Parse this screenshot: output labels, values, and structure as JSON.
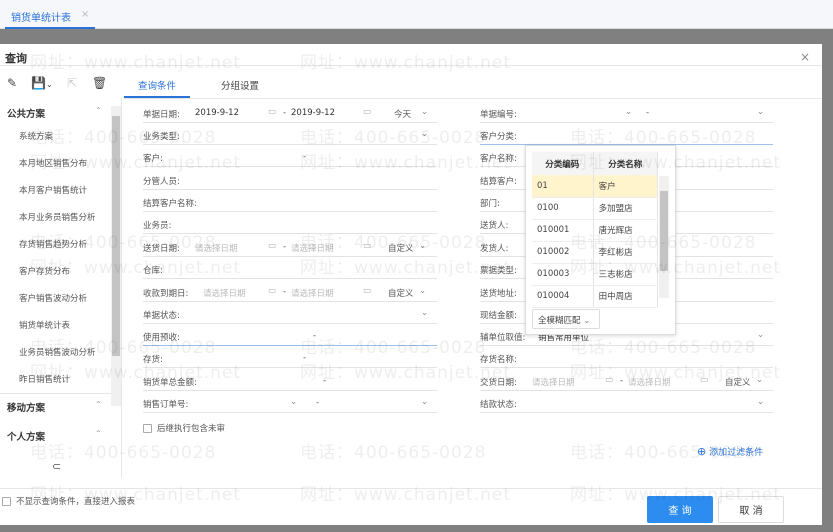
{
  "top_tab": {
    "label": "销货单统计表",
    "close": "×"
  },
  "dialog": {
    "title": "查询",
    "close": "×"
  },
  "watermark": {
    "phone": "电话：400-665-0028",
    "site": "网址：www.chanjet.net"
  },
  "sidebar": {
    "groups": [
      {
        "label": "公共方案"
      },
      {
        "label": "移动方案"
      },
      {
        "label": "个人方案"
      }
    ],
    "items": [
      "系统方案",
      "本月地区销售分布",
      "本月客户销售统计",
      "本月业务员销售分析",
      "存货销售趋势分析",
      "客户存货分布",
      "客户销售波动分析",
      "销货单统计表",
      "业务员销售波动分析",
      "昨日销售统计"
    ]
  },
  "tabs": [
    {
      "label": "查询条件",
      "active": true
    },
    {
      "label": "分组设置",
      "active": false
    }
  ],
  "left_fields": [
    {
      "label": "单据日期:",
      "from": "2019-9-12",
      "to": "2019-9-12",
      "range": "今天"
    },
    {
      "label": "业务类型:"
    },
    {
      "label": "客户:",
      "dash": "-"
    },
    {
      "label": "分管人员:"
    },
    {
      "label": "结算客户名称:"
    },
    {
      "label": "业务员:"
    },
    {
      "label": "送货日期:",
      "from_ph": "请选择日期",
      "to_ph": "请选择日期",
      "range": "自定义"
    },
    {
      "label": "仓库:"
    },
    {
      "label": "收款到期日:",
      "from_ph": "请选择日期",
      "to_ph": "请选择日期",
      "range": "自定义"
    },
    {
      "label": "单据状态:"
    },
    {
      "label": "使用预收:",
      "dash": "-"
    },
    {
      "label": "存货:",
      "dash": "-"
    },
    {
      "label": "销货单总金额:",
      "dash": "-"
    },
    {
      "label": "销售订单号:",
      "dash": "-"
    }
  ],
  "right_fields": [
    {
      "label": "单据编号:",
      "dash": "-"
    },
    {
      "label": "客户分类:"
    },
    {
      "label": "客户名称:"
    },
    {
      "label": "结算客户:"
    },
    {
      "label": "部门:"
    },
    {
      "label": "送货人:"
    },
    {
      "label": "发货人:"
    },
    {
      "label": "票据类型:"
    },
    {
      "label": "送货地址:"
    },
    {
      "label": "现结金额:"
    },
    {
      "label": "辅单位取值:",
      "value": "销售常用单位"
    },
    {
      "label": "存货名称:"
    },
    {
      "label": "交货日期:",
      "from_ph": "请选择日期",
      "to_ph": "请选择日期",
      "range": "自定义"
    },
    {
      "label": "结款状态:"
    }
  ],
  "popup": {
    "headers": [
      "分类编码",
      "分类名称"
    ],
    "rows": [
      [
        "01",
        "客户"
      ],
      [
        "0100",
        "多加盟店"
      ],
      [
        "010001",
        "唐光辉店"
      ],
      [
        "010002",
        "李红彬店"
      ],
      [
        "010003",
        "三志彬店"
      ],
      [
        "010004",
        "田中周店"
      ]
    ],
    "match_mode": "全模糊匹配"
  },
  "include_unaudited": "后继执行包含未审",
  "add_filter": "添加过滤条件",
  "skip_query": "不显示查询条件，直接进入报表",
  "buttons": {
    "query": "查 询",
    "cancel": "取 消"
  },
  "colors": {
    "accent": "#2b73d8",
    "primary_button": "#2d8cf0",
    "selected_row": "#fff4cc"
  }
}
